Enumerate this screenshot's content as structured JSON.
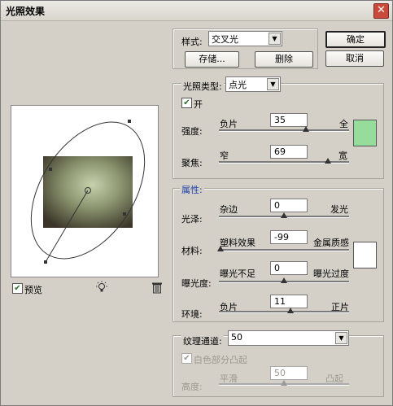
{
  "window": {
    "title": "光照效果",
    "close_glyph": "✕"
  },
  "style": {
    "label": "样式:",
    "value": "交叉光",
    "save": "存储...",
    "delete": "删除"
  },
  "dialog_buttons": {
    "ok": "确定",
    "cancel": "取消"
  },
  "light_type": {
    "label": "光照类型:",
    "value": "点光",
    "on_label": "开",
    "on_checked": true
  },
  "intensity": {
    "label": "强度:",
    "left": "负片",
    "right": "全",
    "value": "35",
    "level_percent": 67
  },
  "focus": {
    "label": "聚焦:",
    "left": "窄",
    "right": "宽",
    "value": "69",
    "level_percent": 84
  },
  "light_color": "#96dc9a",
  "properties": {
    "heading": "属性:",
    "gloss": {
      "label": "光泽:",
      "left": "杂边",
      "right": "发光",
      "value": "0",
      "level_percent": 50
    },
    "material": {
      "label": "材料:",
      "left": "塑料效果",
      "right": "金属质感",
      "value": "-99",
      "level_percent": 1
    },
    "exposure": {
      "label": "曝光度:",
      "left": "曝光不足",
      "right": "曝光过度",
      "value": "0",
      "level_percent": 50
    },
    "ambience": {
      "label": "环境:",
      "left": "负片",
      "right": "正片",
      "value": "11",
      "level_percent": 55
    },
    "color": "#ffffff"
  },
  "texture": {
    "label": "纹理通道:",
    "value": "50",
    "white_high_label": "白色部分凸起",
    "white_high_checked": true,
    "height_label": "高度:",
    "left": "平滑",
    "right": "凸起",
    "level_percent": 50
  },
  "preview": {
    "label": "预览",
    "checked": true
  },
  "icons": {
    "bulb": "light-bulb-icon",
    "trash": "trash-icon"
  }
}
